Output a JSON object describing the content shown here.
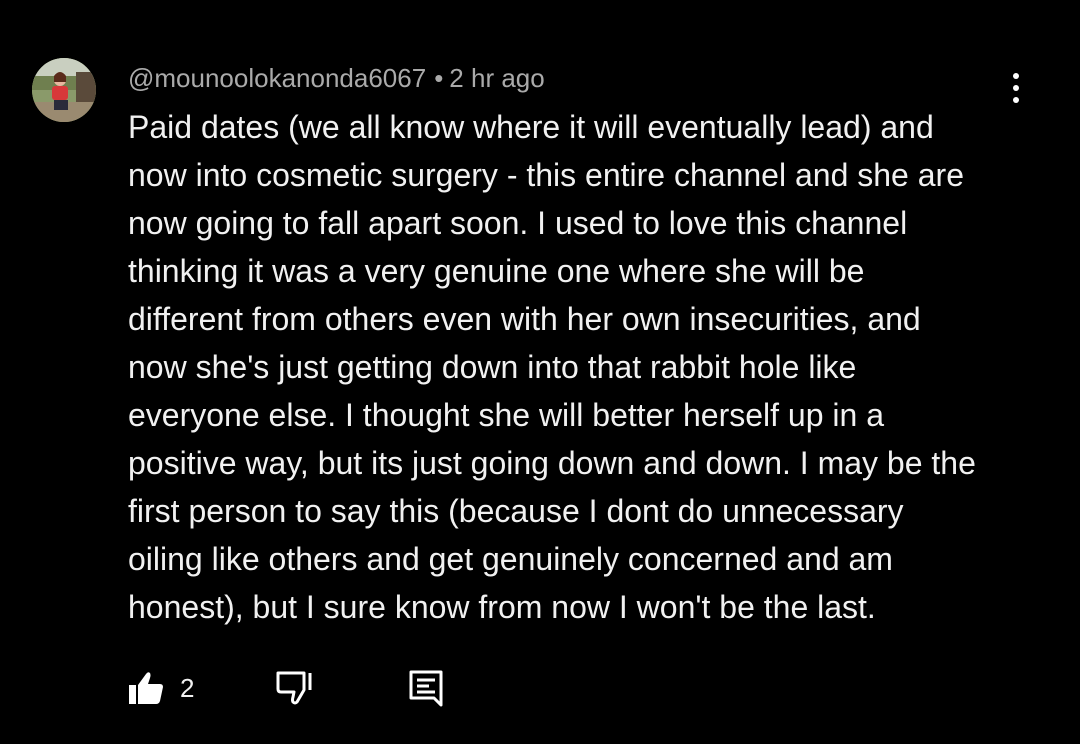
{
  "comment": {
    "author": "@mounoolokanonda6067",
    "separator": "•",
    "time": "2 hr ago",
    "text_lines": [
      "Paid dates (we all know where it will eventually lead) and",
      "now into cosmetic surgery - this entire channel and she are",
      "now going to fall apart soon. I used to love this channel",
      "thinking it was a very genuine one where she will be",
      "different from others even with her own insecurities, and",
      "now she's just getting down into that rabbit hole like",
      "everyone else. I thought she will better herself up in a",
      "positive way, but its just going down and down. I may be the",
      "first person to say this (because I dont do unnecessary",
      "oiling like others and get genuinely concerned and am",
      "honest), but I sure know from now I won't be the last."
    ],
    "like_count": "2"
  },
  "icons": {
    "menu": "more-vertical-icon",
    "like": "thumbs-up-icon",
    "dislike": "thumbs-down-icon",
    "reply": "reply-comment-icon"
  },
  "colors": {
    "background": "#000000",
    "text": "#f1f1f1",
    "meta_text": "#aaaaaa"
  }
}
